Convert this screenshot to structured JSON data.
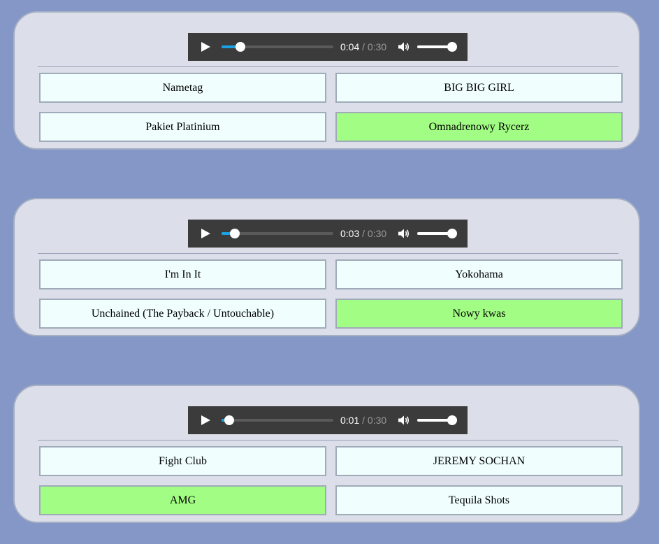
{
  "colors": {
    "background": "#8497c6",
    "card": "#dcdfe9",
    "option": "#f0fffe",
    "correct_option": "#a2fd84",
    "player": "#3b3b3b",
    "progress_accent": "#1ba1e2"
  },
  "questions": [
    {
      "player": {
        "current_time": "0:04",
        "separator": "/",
        "duration": "0:30",
        "progress_fraction": 0.17,
        "volume_fraction": 1.0
      },
      "options": [
        {
          "label": "Nametag",
          "correct": false
        },
        {
          "label": "BIG BIG GIRL",
          "correct": false
        },
        {
          "label": "Pakiet Platinium",
          "correct": false
        },
        {
          "label": "Omnadrenowy Rycerz",
          "correct": true
        }
      ]
    },
    {
      "player": {
        "current_time": "0:03",
        "separator": "/",
        "duration": "0:30",
        "progress_fraction": 0.12,
        "volume_fraction": 1.0
      },
      "options": [
        {
          "label": "I'm In It",
          "correct": false
        },
        {
          "label": "Yokohama",
          "correct": false
        },
        {
          "label": "Unchained (The Payback / Untouchable)",
          "correct": false
        },
        {
          "label": "Nowy kwas",
          "correct": true
        }
      ]
    },
    {
      "player": {
        "current_time": "0:01",
        "separator": "/",
        "duration": "0:30",
        "progress_fraction": 0.07,
        "volume_fraction": 1.0
      },
      "options": [
        {
          "label": "Fight Club",
          "correct": false
        },
        {
          "label": "JEREMY SOCHAN",
          "correct": false
        },
        {
          "label": "AMG",
          "correct": true
        },
        {
          "label": "Tequila Shots",
          "correct": false
        }
      ]
    }
  ]
}
